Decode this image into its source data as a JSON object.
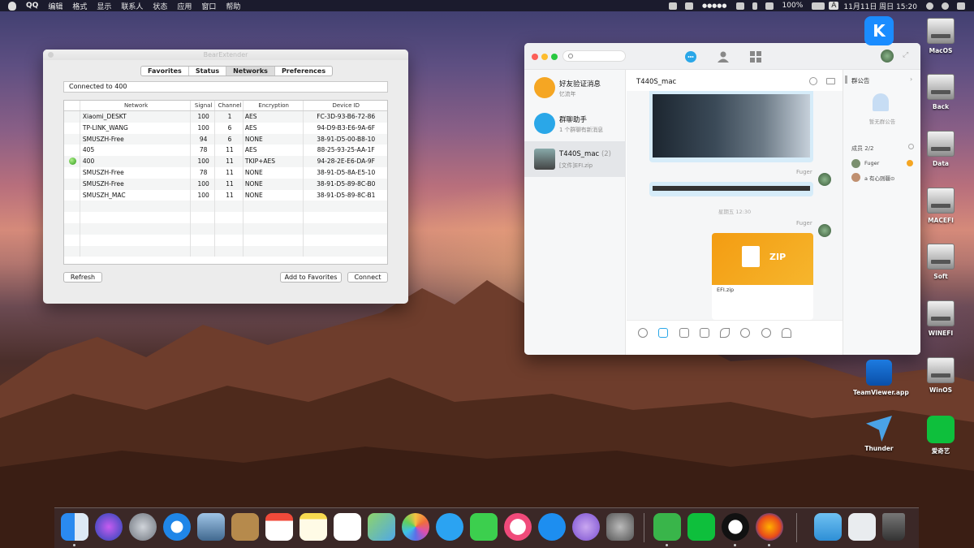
{
  "menubar": {
    "app": "QQ",
    "menus": [
      "编辑",
      "格式",
      "显示",
      "联系人",
      "状态",
      "应用",
      "窗口",
      "帮助"
    ],
    "signal": "●●●●●",
    "battery": "100%",
    "input_source": "A",
    "datetime": "11月11日 周日 15:20"
  },
  "bear": {
    "title": "BearExtender",
    "tabs": [
      "Favorites",
      "Status",
      "Networks",
      "Preferences"
    ],
    "active_tab": "Networks",
    "status": "Connected to 400",
    "columns": [
      "Network",
      "Signal",
      "Channel",
      "Encryption",
      "Device ID"
    ],
    "rows": [
      {
        "name": "Xiaomi_DESKT",
        "signal": "100",
        "channel": "1",
        "enc": "AES",
        "id": "FC-3D-93-B6-72-86",
        "connected": false
      },
      {
        "name": "TP-LINK_WANG",
        "signal": "100",
        "channel": "6",
        "enc": "AES",
        "id": "94-D9-B3-E6-9A-6F",
        "connected": false
      },
      {
        "name": "SMUSZH-Free",
        "signal": "94",
        "channel": "6",
        "enc": "NONE",
        "id": "38-91-D5-00-B8-10",
        "connected": false
      },
      {
        "name": "405",
        "signal": "78",
        "channel": "11",
        "enc": "AES",
        "id": "88-25-93-25-AA-1F",
        "connected": false
      },
      {
        "name": "400",
        "signal": "100",
        "channel": "11",
        "enc": "TKIP+AES",
        "id": "94-28-2E-E6-DA-9F",
        "connected": true
      },
      {
        "name": "SMUSZH-Free",
        "signal": "78",
        "channel": "11",
        "enc": "NONE",
        "id": "38-91-D5-8A-E5-10",
        "connected": false
      },
      {
        "name": "SMUSZH-Free",
        "signal": "100",
        "channel": "11",
        "enc": "NONE",
        "id": "38-91-D5-89-8C-B0",
        "connected": false
      },
      {
        "name": "SMUSZH_MAC",
        "signal": "100",
        "channel": "11",
        "enc": "NONE",
        "id": "38-91-D5-89-8C-B1",
        "connected": false
      }
    ],
    "buttons": {
      "refresh": "Refresh",
      "add": "Add to Favorites",
      "connect": "Connect"
    }
  },
  "qq": {
    "conversations": [
      {
        "title": "好友验证消息",
        "sub": "忆流年",
        "color": "#f5a623"
      },
      {
        "title": "群聊助手",
        "sub": "1 个群聊有新消息",
        "color": "#2aa7e8"
      },
      {
        "title": "T440S_mac",
        "badge": "(2)",
        "sub": "[文件]EFI.zip",
        "color": "#6a6a6a"
      }
    ],
    "chat_title": "T440S_mac",
    "sender1": "Fuger",
    "sender2": "Fuger",
    "time_sep": "星期五 12:30",
    "zip_label": "ZIP",
    "file_name": "EFI.zip",
    "notice_title": "群公告",
    "notice_empty": "暂无群公告",
    "members_title": "成员 2/2",
    "members": [
      "Fuger",
      "a 有心则疆⊙"
    ]
  },
  "desktop": {
    "icons": [
      "MacOS",
      "Back",
      "Data",
      "MACEFI",
      "Soft",
      "WINEFI",
      "WinOS"
    ],
    "apps": [
      "TeamViewer.app",
      "Thunder",
      "爱奇艺"
    ]
  },
  "colors": {
    "accent": "#2aa7e8",
    "green": "#39b54a",
    "zip": "#f39c12"
  }
}
